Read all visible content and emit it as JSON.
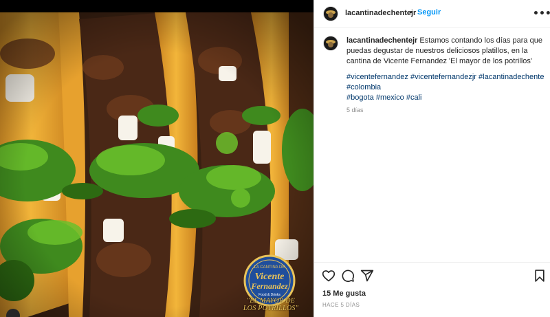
{
  "post": {
    "username": "lacantinadechentejr",
    "separator": "•",
    "follow_label": "Seguir",
    "more_label": "•••",
    "caption": {
      "username": "lacantinadechentejr",
      "text": "Estamos contando los días para que puedas degustar de nuestros deliciosos platillos, en la cantina de Vicente Fernandez 'El mayor de los potrillos'",
      "hashtags_line1": [
        "#vicentefernandez",
        "#vicentefernandezjr",
        "#lacantinadechente",
        "#colombia"
      ],
      "hashtags_line2": [
        "#bogota",
        "#mexico",
        "#cali"
      ],
      "time": "5 días"
    },
    "likes": "15 Me gusta",
    "posted": "HACE 5 DÍAS"
  },
  "image": {
    "logo_text": [
      "LA CANTINA DE",
      "Vicente",
      "Fernandez",
      "Food & Drinks"
    ],
    "slogan_line1": "\"EL MAYOR DE",
    "slogan_line2": "LOS POTRILLOS\""
  },
  "icons": {
    "more": "more-horizontal-icon",
    "like": "heart-icon",
    "comment": "comment-bubble-icon",
    "share": "paper-plane-icon",
    "save": "bookmark-icon",
    "user_tag": "user-tag-icon"
  },
  "colors": {
    "link": "#0095f6",
    "hashtag": "#00376b",
    "meta": "#8e8e8e",
    "logo_gold": "#e9c35a",
    "logo_blue": "#1f4e9c"
  }
}
